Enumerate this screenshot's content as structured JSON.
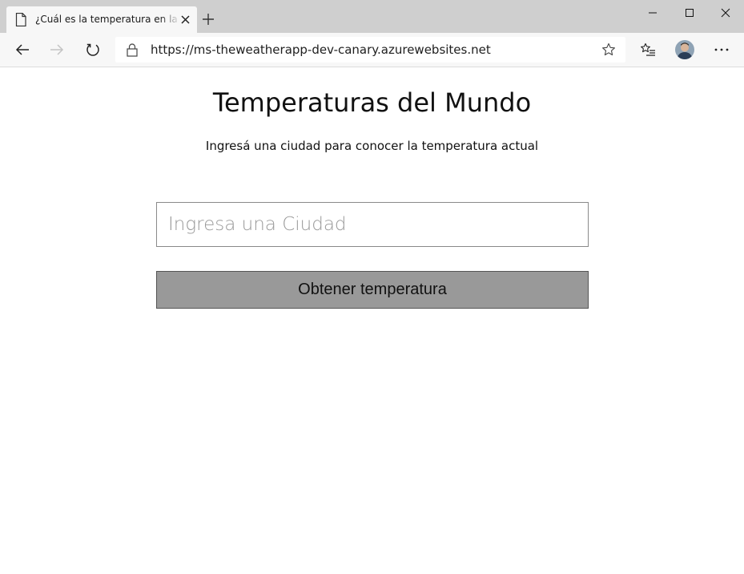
{
  "browser": {
    "tab": {
      "title": "¿Cuál es la temperatura en la ciudad?",
      "icon": "page-icon"
    },
    "address_bar": {
      "url": "https://ms-theweatherapp-dev-canary.azurewebsites.net"
    },
    "icons": {
      "back": "back-arrow-icon",
      "forward": "forward-arrow-icon",
      "reload": "reload-icon",
      "lock": "lock-icon",
      "favorite": "star-icon",
      "favorites_list": "favorites-list-icon",
      "profile": "avatar",
      "more": "more-menu-icon",
      "new_tab": "plus-icon",
      "window_controls": [
        "minimize-icon",
        "maximize-icon",
        "close-icon"
      ]
    },
    "colors": {
      "tab_strip": "#cfcfcf",
      "toolbar": "#f7f7f7"
    }
  },
  "page": {
    "title": "Temperaturas del Mundo",
    "subtitle": "Ingresá una ciudad para conocer la temperatura actual",
    "city_input": {
      "placeholder": "Ingresa una Ciudad",
      "value": ""
    },
    "submit_button": {
      "label": "Obtener temperatura"
    },
    "colors": {
      "button_bg": "#999999",
      "input_border": "#8a8a8a"
    }
  }
}
